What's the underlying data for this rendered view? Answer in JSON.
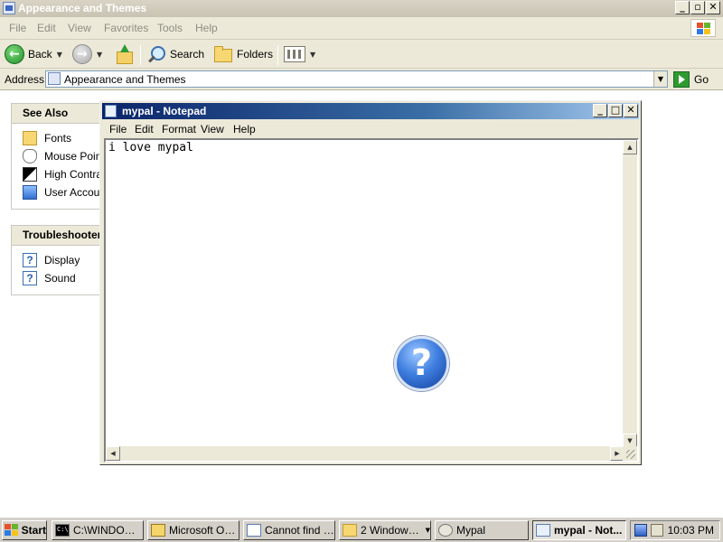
{
  "explorer": {
    "title": "Appearance and Themes",
    "menu": [
      "File",
      "Edit",
      "View",
      "Favorites",
      "Tools",
      "Help"
    ],
    "toolbar": {
      "back_label": "Back",
      "search_label": "Search",
      "folders_label": "Folders"
    },
    "address": {
      "label": "Address",
      "value": "Appearance and Themes",
      "go_label": "Go"
    },
    "see_also": {
      "heading": "See Also",
      "items": [
        "Fonts",
        "Mouse Pointers",
        "High Contrast",
        "User Account"
      ]
    },
    "troubleshooters": {
      "heading": "Troubleshooters",
      "items": [
        "Display",
        "Sound"
      ]
    }
  },
  "notepad": {
    "title": "mypal - Notepad",
    "menu": [
      "File",
      "Edit",
      "Format",
      "View",
      "Help"
    ],
    "content": "i love mypal"
  },
  "taskbar": {
    "start_label": "Start",
    "tasks": [
      {
        "label": "C:\\WINDOW...",
        "icon": "command-prompt-icon"
      },
      {
        "label": "Microsoft Out...",
        "icon": "outlook-icon"
      },
      {
        "label": "Cannot find s...",
        "icon": "browser-page-icon"
      },
      {
        "label": "2 Windows ...",
        "icon": "folder-icon"
      },
      {
        "label": "Mypal",
        "icon": "mypal-icon"
      },
      {
        "label": "mypal - Not...",
        "icon": "notepad-icon"
      }
    ],
    "clock": "10:03 PM"
  }
}
